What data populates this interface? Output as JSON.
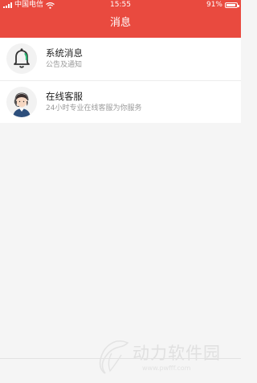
{
  "status_bar": {
    "carrier": "中国电信",
    "time": "15:55",
    "battery": "91%",
    "battery_level": 0.91
  },
  "header": {
    "title": "消息"
  },
  "messages": [
    {
      "title": "系统消息",
      "subtitle": "公告及通知",
      "icon": "bell-icon"
    },
    {
      "title": "在线客服",
      "subtitle": "24小时专业在线客服为你服务",
      "icon": "customer-service-avatar-icon"
    }
  ],
  "watermark": {
    "brand": "动力软件园",
    "url": "www.pwfff.com"
  },
  "colors": {
    "header_bg": "#e94a3f",
    "background": "#f5f5f5"
  }
}
